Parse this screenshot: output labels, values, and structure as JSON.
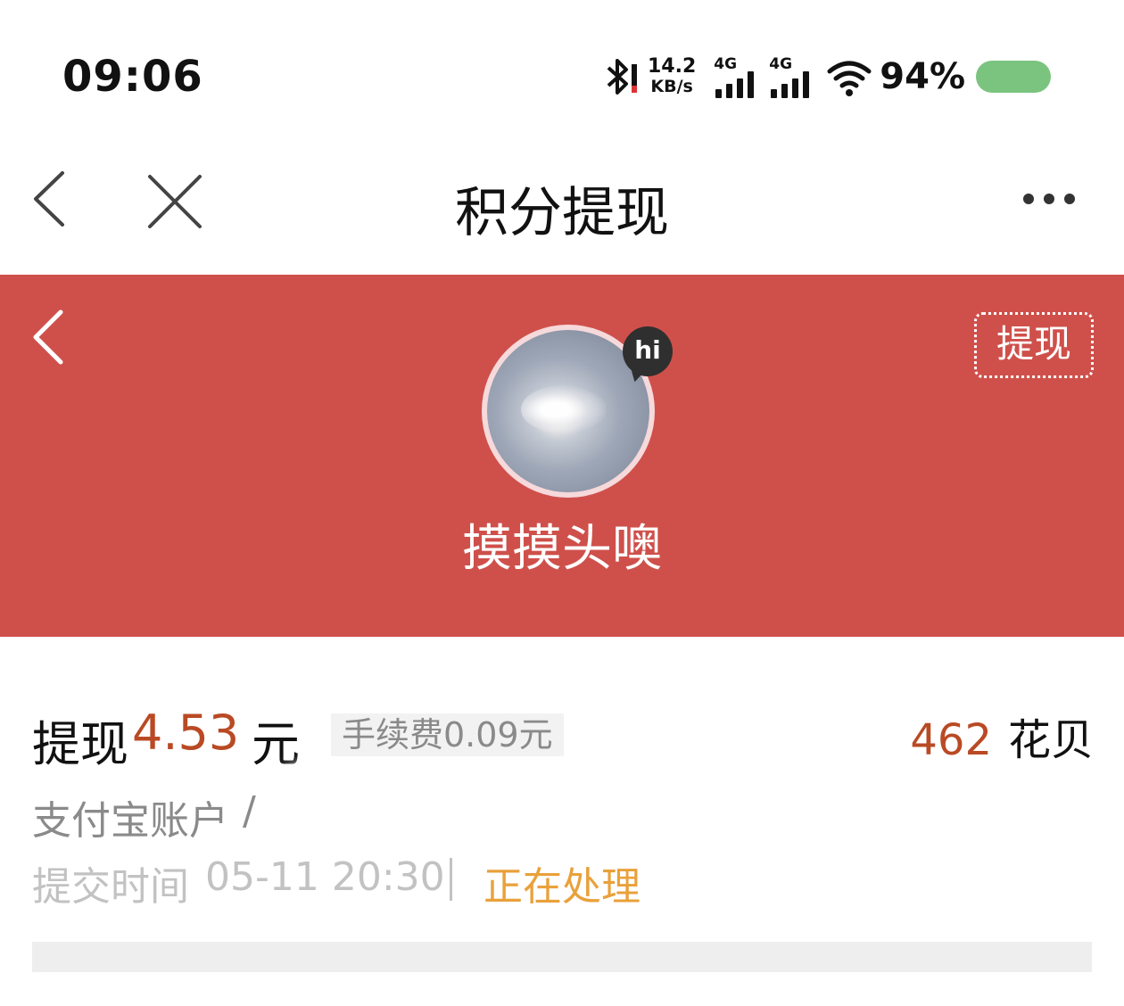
{
  "status_bar": {
    "time": "09:06",
    "net_speed_value": "14.2",
    "net_speed_unit": "KB/s",
    "sim1_tag": "4G",
    "sim2_tag": "4G",
    "battery_percent": "94%",
    "icons": [
      "bluetooth-icon",
      "signal-icon",
      "wifi-icon",
      "battery-icon"
    ],
    "battery_color": "#7bc47f"
  },
  "nav": {
    "title": "积分提现",
    "icons": [
      "back-icon",
      "close-icon",
      "more-icon"
    ]
  },
  "hero": {
    "background_color": "#cf504b",
    "withdraw_button": "提现",
    "hi_badge": "hi",
    "username": "摸摸头噢"
  },
  "record": {
    "withdraw_label": "提现",
    "amount": "4.53",
    "unit": "元",
    "fee": "手续费0.09元",
    "points_value": "462",
    "points_unit": "花贝",
    "account_label": "支付宝账户",
    "account_separator": "/",
    "submit_label": "提交时间",
    "submit_time": "05-11 20:30",
    "status": "正在处理",
    "amount_color": "#b94a24",
    "status_color": "#e9a13b"
  }
}
